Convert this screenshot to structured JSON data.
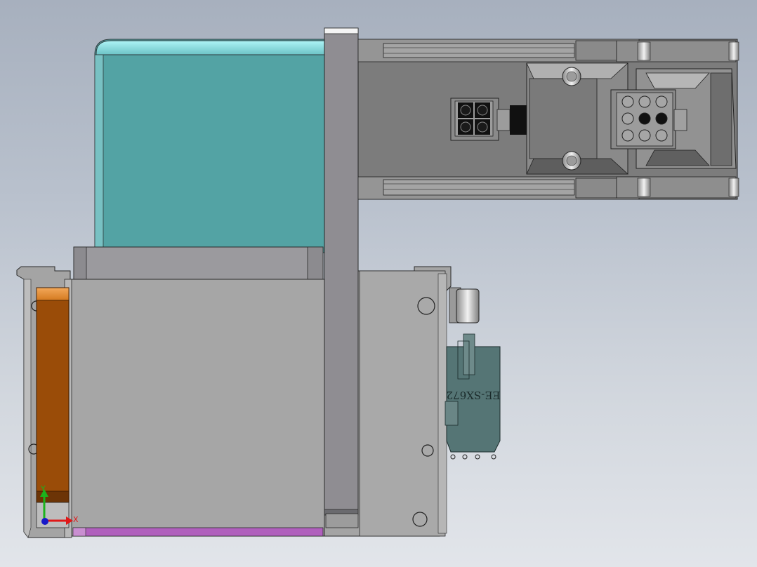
{
  "scene": {
    "background_color": "#b9c1cd",
    "sensor_label": "EE-SX672",
    "colors": {
      "motor_teal": "#53a3a4",
      "frame_gray": "#a8a8a8",
      "plate_gray": "#8e8c90",
      "actuator_gray": "#7c7c7c",
      "orange_part": "#9a4c08",
      "magenta_strip": "#b25ec0",
      "sensor_teal": "#557575"
    }
  },
  "triad": {
    "x_label": "X",
    "y_label": "Y",
    "x_color": "#e01818",
    "y_color": "#1cb31c",
    "origin_color": "#1818c8"
  }
}
